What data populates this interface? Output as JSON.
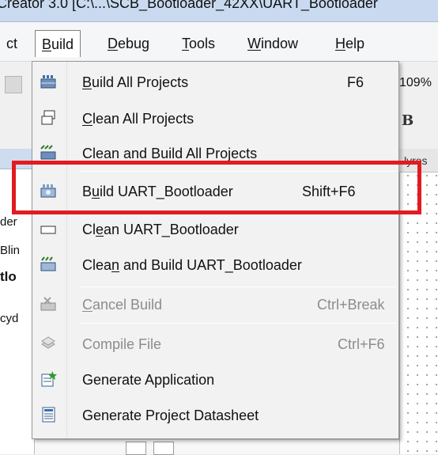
{
  "window": {
    "title": "Creator 3.0  [C:\\...\\SCB_Bootloader_42XX\\UART_Bootloader"
  },
  "menubar": {
    "items": [
      {
        "label": "ct",
        "mnemonic": ""
      },
      {
        "label": "Build",
        "mnemonic": "B"
      },
      {
        "label": "Debug",
        "mnemonic": "D"
      },
      {
        "label": "Tools",
        "mnemonic": "T"
      },
      {
        "label": "Window",
        "mnemonic": "W"
      },
      {
        "label": "Help",
        "mnemonic": "H"
      }
    ]
  },
  "background": {
    "zoom_level": "109%",
    "bold_button": "B",
    "right_tab_label": "lyres",
    "left_panel_lines": [
      "der",
      "Blin",
      "tlo",
      "cyd"
    ]
  },
  "build_menu": {
    "items": [
      {
        "pre": "",
        "u": "B",
        "post": "uild All Projects",
        "shortcut": "F6",
        "icon": "build-all-icon",
        "disabled": false
      },
      {
        "pre": "",
        "u": "C",
        "post": "lean All Projects",
        "shortcut": "",
        "icon": "clean-all-icon",
        "disabled": false
      },
      {
        "pre": "Clean and Build All Projects",
        "u": "",
        "post": "",
        "shortcut": "",
        "icon": "clean-build-all-icon",
        "disabled": false
      },
      {
        "pre": "B",
        "u": "u",
        "post": "ild UART_Bootloader",
        "shortcut": "Shift+F6",
        "icon": "build-project-icon",
        "disabled": false
      },
      {
        "pre": "Cl",
        "u": "e",
        "post": "an UART_Bootloader",
        "shortcut": "",
        "icon": "clean-project-icon",
        "disabled": false
      },
      {
        "pre": "Clea",
        "u": "n",
        "post": " and Build UART_Bootloader",
        "shortcut": "",
        "icon": "clean-build-project-icon",
        "disabled": false
      },
      {
        "pre": "",
        "u": "C",
        "post": "ancel Build",
        "shortcut": "Ctrl+Break",
        "icon": "cancel-build-icon",
        "disabled": true
      },
      {
        "pre": "Compile File",
        "u": "",
        "post": "",
        "shortcut": "Ctrl+F6",
        "icon": "compile-file-icon",
        "disabled": true
      },
      {
        "pre": "Generate Application",
        "u": "",
        "post": "",
        "shortcut": "",
        "icon": "generate-application-icon",
        "disabled": false
      },
      {
        "pre": "Generate Project Datasheet",
        "u": "",
        "post": "",
        "shortcut": "",
        "icon": "generate-datasheet-icon",
        "disabled": false
      }
    ]
  },
  "colors": {
    "highlight": "#e21b22",
    "disabled_text": "#8c8c8c",
    "menu_background": "#f2f2f2"
  }
}
